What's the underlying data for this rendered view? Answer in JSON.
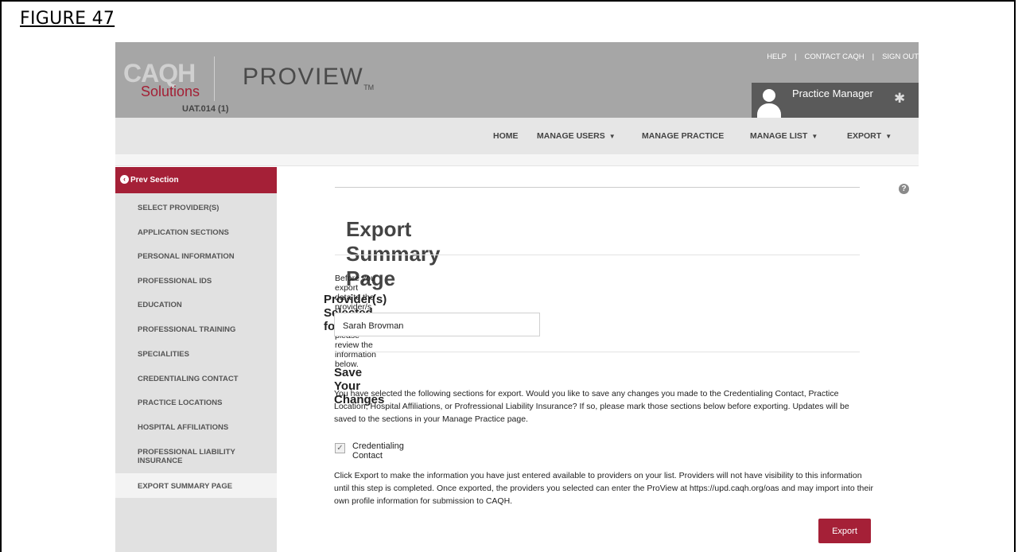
{
  "figure_label": "FIGURE 47",
  "header": {
    "logo_caqh": "CAQH",
    "logo_solutions": "Solutions",
    "product": "PROVIEW",
    "product_tm": "TM",
    "org_id": "UAT.014 (1)",
    "links": [
      "HELP",
      "CONTACT CAQH",
      "SIGN OUT"
    ],
    "user_name": "Practice Manager"
  },
  "nav": {
    "items": [
      {
        "label": "HOME",
        "has_dropdown": false
      },
      {
        "label": "MANAGE USERS",
        "has_dropdown": true
      },
      {
        "label": "MANAGE PRACTICE",
        "has_dropdown": false
      },
      {
        "label": "MANAGE LIST",
        "has_dropdown": true
      },
      {
        "label": "EXPORT",
        "has_dropdown": true
      }
    ]
  },
  "sidebar": {
    "prev_label": "Prev Section",
    "items": [
      "SELECT PROVIDER(S)",
      "APPLICATION SECTIONS",
      "PERSONAL INFORMATION",
      "PROFESSIONAL IDS",
      "EDUCATION",
      "PROFESSIONAL TRAINING",
      "SPECIALITIES",
      "CREDENTIALING CONTACT",
      "PRACTICE LOCATIONS",
      "HOSPITAL AFFILIATIONS",
      "PROFESSIONAL LIABILITY INSURANCE",
      "EXPORT SUMMARY PAGE"
    ],
    "active": "EXPORT SUMMARY PAGE"
  },
  "main": {
    "title": "Export Summary Page",
    "intro": "Before you export data to the provider/s you've selected please review the information below.",
    "providers_heading": "Provider(s) Selected for Export",
    "providers": [
      "Sarah Brovman"
    ],
    "save_heading": "Save Your Changes",
    "save_text": "You have selected the following sections for export. Would you like to save any changes you made to the Credentialing Contact, Practice Location, Hospital Affiliations, or Profressional Liability Insurance? If so, please mark those sections below before exporting. Updates will be saved to the sections in your Manage Practice page.",
    "checkbox_label": "Credentialing Contact",
    "checkbox_checked": true,
    "export_text": "Click Export to make the information you have just entered available to providers on your list. Providers will not have visibility to this information until this step is completed. Once exported, the providers you selected can enter the ProView at https://upd.caqh.org/oas and may import into their own profile information for submission to CAQH.",
    "export_button": "Export"
  },
  "colors": {
    "brand_red": "#a52037",
    "header_gray": "#a6a6a6",
    "nav_gray": "#e6e6e6",
    "sidebar_gray": "#e1e1e1"
  }
}
